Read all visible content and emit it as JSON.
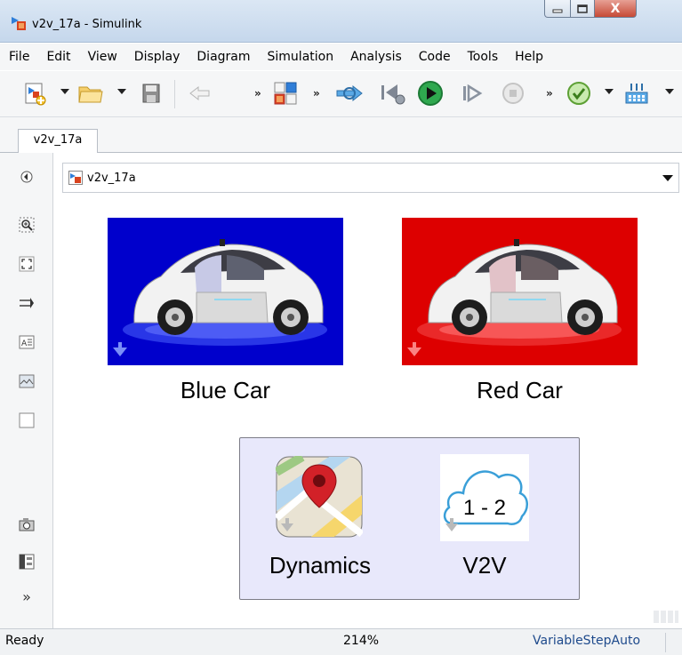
{
  "window": {
    "title": "v2v_17a - Simulink",
    "close_glyph": "X"
  },
  "menu": [
    "File",
    "Edit",
    "View",
    "Display",
    "Diagram",
    "Simulation",
    "Analysis",
    "Code",
    "Tools",
    "Help"
  ],
  "toolbar": {
    "more_glyph": "»",
    "icons": [
      "new-model-icon",
      "open-folder-icon",
      "save-icon",
      "back-arrow-icon",
      "library-browser-icon",
      "update-diagram-icon",
      "step-back-icon",
      "run-icon",
      "step-forward-icon",
      "stop-icon",
      "model-advisor-icon",
      "build-icon"
    ]
  },
  "tab": {
    "label": "v2v_17a"
  },
  "address": {
    "crumb": "v2v_17a"
  },
  "palette": {
    "more_glyph": "»",
    "icons": [
      "hide-browser-icon",
      "zoom-icon",
      "fit-to-view-icon",
      "signal-arrow-icon",
      "annotation-icon",
      "image-icon",
      "area-icon",
      "camera-icon",
      "model-browser-icon"
    ]
  },
  "canvas": {
    "blue_car": {
      "label": "Blue Car",
      "bg": "#0000cc"
    },
    "red_car": {
      "label": "Red Car",
      "bg": "#dd0000"
    },
    "area": {
      "dynamics": {
        "label": "Dynamics"
      },
      "v2v": {
        "label": "V2V",
        "icon_text": "1 - 2"
      }
    }
  },
  "status": {
    "state": "Ready",
    "zoom": "214%",
    "solver": "VariableStepAuto"
  }
}
